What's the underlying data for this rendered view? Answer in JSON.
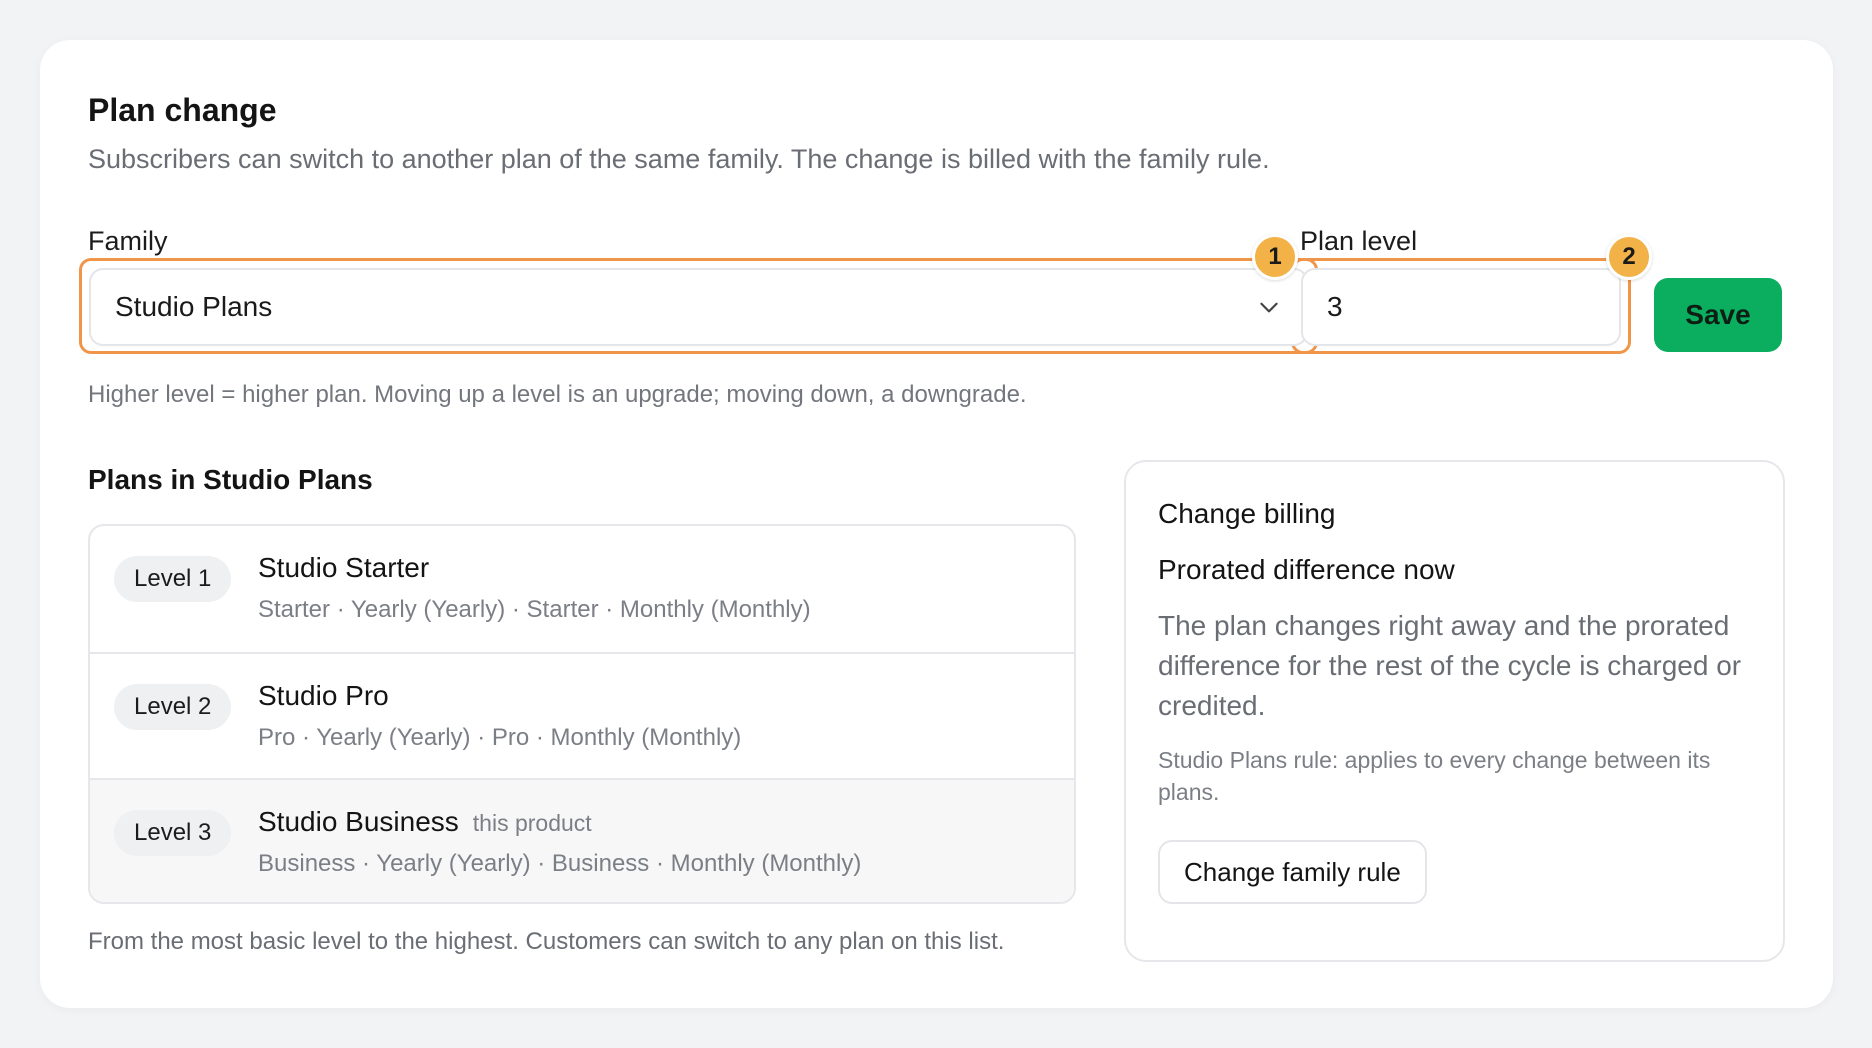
{
  "header": {
    "title": "Plan change",
    "subtitle": "Subscribers can switch to another plan of the same family. The change is billed with the family rule."
  },
  "form": {
    "family_label": "Family",
    "family_value": "Studio Plans",
    "level_label": "Plan level",
    "level_value": "3",
    "save_label": "Save",
    "hint": "Higher level = higher plan. Moving up a level is an upgrade; moving down, a downgrade.",
    "badges": [
      "1",
      "2"
    ],
    "highlight_color": "#f0954a",
    "badge_color": "#f3b247",
    "save_color": "#0aae5e"
  },
  "plans": {
    "heading": "Plans in Studio Plans",
    "items": [
      {
        "level": "Level 1",
        "name": "Studio Starter",
        "tag": "",
        "desc": "Starter · Yearly (Yearly) · Starter · Monthly (Monthly)"
      },
      {
        "level": "Level 2",
        "name": "Studio Pro",
        "tag": "",
        "desc": "Pro · Yearly (Yearly) · Pro · Monthly (Monthly)"
      },
      {
        "level": "Level 3",
        "name": "Studio Business",
        "tag": "this product",
        "desc": "Business · Yearly (Yearly) · Business · Monthly (Monthly)"
      }
    ],
    "footer": "From the most basic level to the highest. Customers can switch to any plan on this list."
  },
  "billing": {
    "title": "Change billing",
    "mode": "Prorated difference now",
    "description": "The plan changes right away and the prorated difference for the rest of the cycle is charged or credited.",
    "rule": "Studio Plans rule: applies to every change between its plans.",
    "button_label": "Change family rule"
  },
  "icons": {
    "select": "chevron-down-icon"
  }
}
